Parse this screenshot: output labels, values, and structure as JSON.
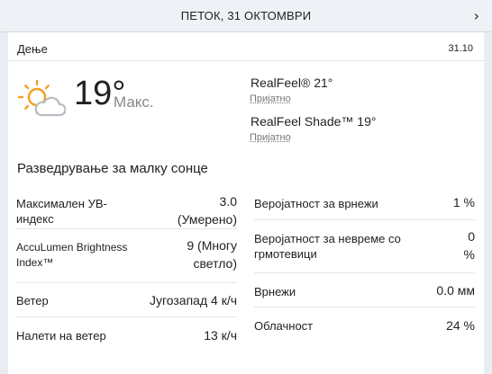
{
  "header": {
    "title": "ПЕТОК, 31 ОКТОМВРИ",
    "next_icon": "chevron-right-icon"
  },
  "day": {
    "label": "Дење",
    "date": "31.10"
  },
  "current": {
    "icon": "partly-sunny-icon",
    "temperature": "19°",
    "temp_label": "Макс.",
    "realfeel": "RealFeel® 21°",
    "realfeel_desc": "Пријатно",
    "realfeel_shade": "RealFeel Shade™ 19°",
    "realfeel_shade_desc": "Пријатно"
  },
  "phrase": "Разведрување за малку сонце",
  "details_left": [
    {
      "label": "Максимален УВ-\nиндекс",
      "value": "3.0\n(Умерено)"
    },
    {
      "label": "AccuLumen Brightness\nIndex™",
      "value": "9 (Многу\nсветло)"
    },
    {
      "label": "Ветер",
      "value": "Југозапад 4 к/ч"
    },
    {
      "label": "Налети на ветер",
      "value": "13 к/ч"
    }
  ],
  "details_right": [
    {
      "label": "Веројатност за врнежи",
      "value": "1 %"
    },
    {
      "label": "Веројатност за невреме со\nгрмотевици",
      "value": "0\n%"
    },
    {
      "label": "Врнежи",
      "value": "0.0 мм"
    },
    {
      "label": "Облачност",
      "value": "24 %"
    }
  ],
  "colors": {
    "sun": "#f0a020",
    "cloud": "#b8bcc2",
    "background": "#e9edf2"
  }
}
